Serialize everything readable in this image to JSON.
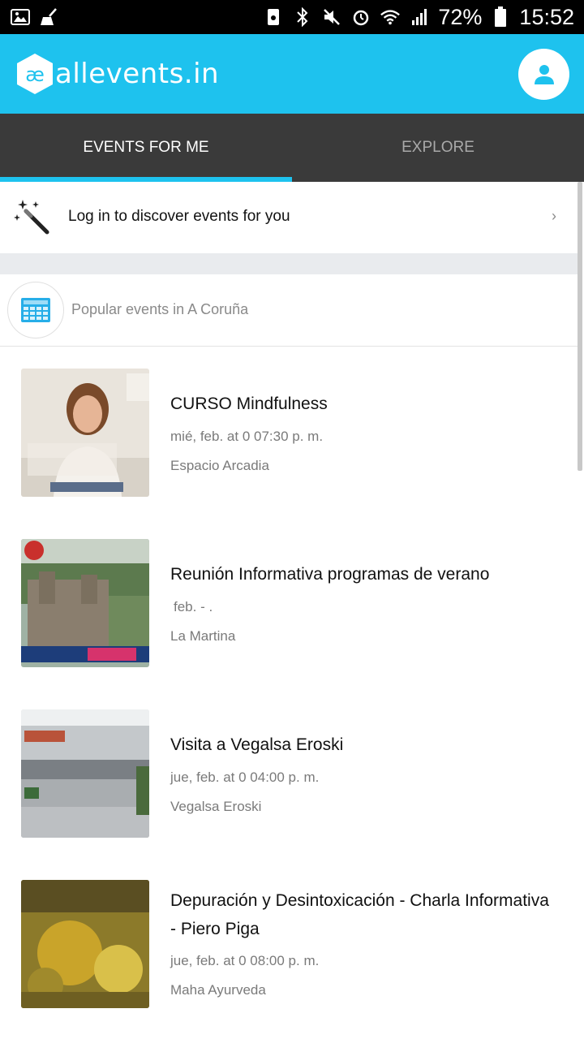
{
  "status_bar": {
    "battery": "72%",
    "time": "15:52",
    "icons": [
      "image-icon",
      "cleaner-icon",
      "storage-icon",
      "bluetooth-icon",
      "mute-icon",
      "alarm-icon",
      "wifi-icon",
      "signal-icon",
      "battery-icon"
    ]
  },
  "app_bar": {
    "logo_text": "allevents.in",
    "brand_color": "#1ec2ee"
  },
  "tabs": [
    {
      "label": "EVENTS FOR ME",
      "active": true
    },
    {
      "label": "EXPLORE",
      "active": false
    }
  ],
  "login_prompt": {
    "text": "Log in to discover events for you",
    "chevron": "›"
  },
  "section": {
    "title": "Popular events in A Coruña"
  },
  "events": [
    {
      "title": "CURSO Mindfulness",
      "date": "mié,  feb.  at 0 07:30 p. m.",
      "venue": "Espacio Arcadia"
    },
    {
      "title": "Reunión Informativa programas de verano",
      "date": "feb.  - .",
      "venue": "La Martina"
    },
    {
      "title": "Visita a Vegalsa Eroski",
      "date": "jue,  feb.  at 0 04:00 p. m.",
      "venue": "Vegalsa Eroski"
    },
    {
      "title": "Depuración y Desintoxicación - Charla Informativa - Piero Piga",
      "date": "jue,  feb.  at 0 08:00 p. m.",
      "venue": "Maha Ayurveda"
    }
  ]
}
